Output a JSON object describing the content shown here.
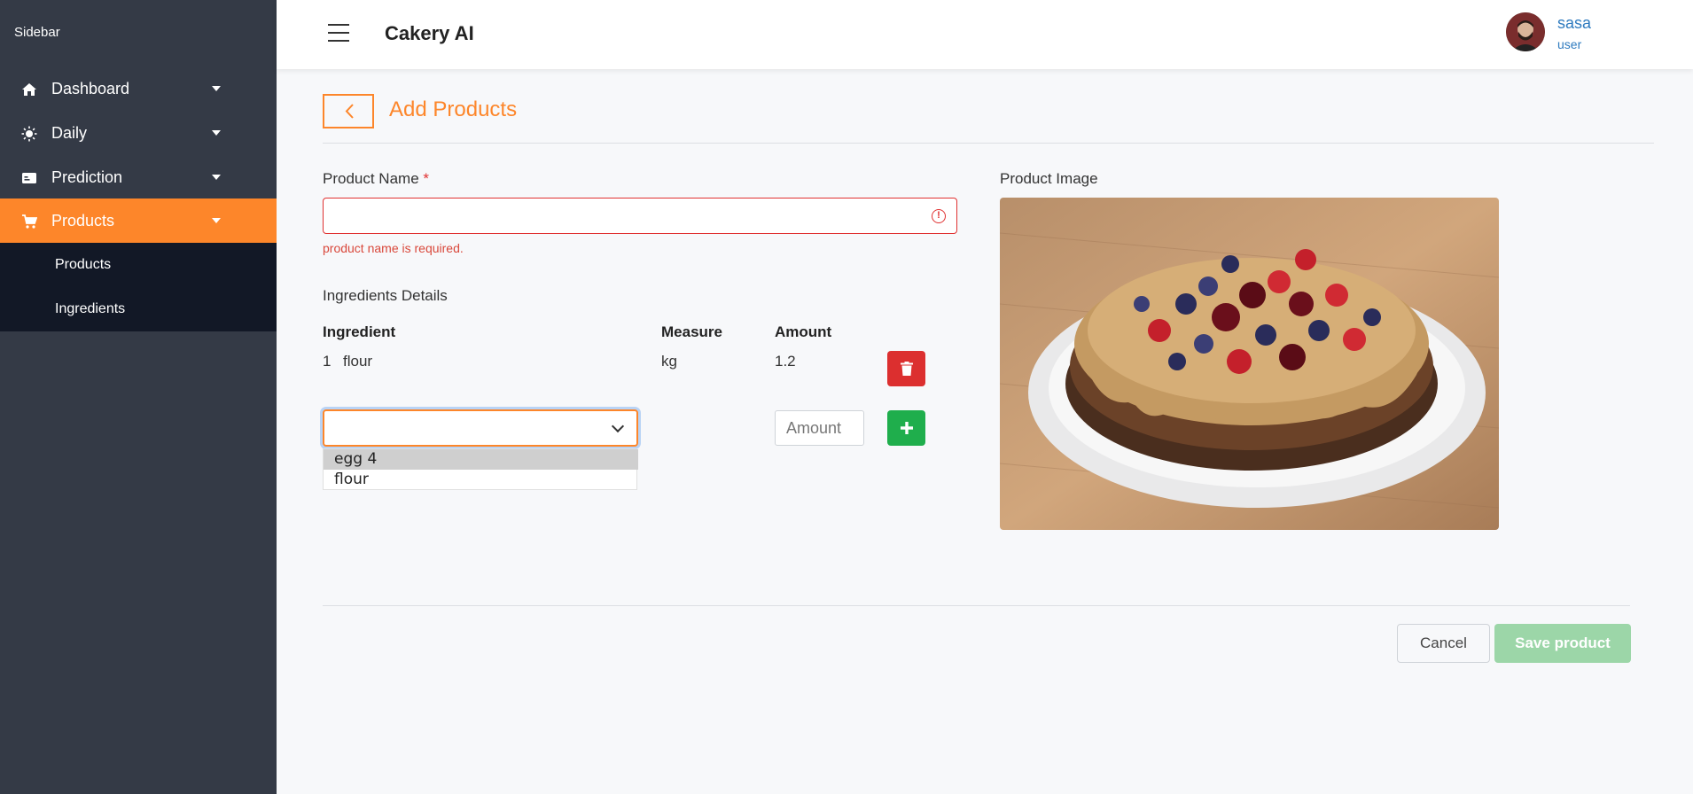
{
  "sidebar": {
    "title": "Sidebar",
    "items": [
      {
        "label": "Dashboard",
        "icon": "home-icon"
      },
      {
        "label": "Daily",
        "icon": "sun-icon"
      },
      {
        "label": "Prediction",
        "icon": "terminal-icon"
      },
      {
        "label": "Products",
        "icon": "cart-icon",
        "active": true
      }
    ],
    "submenu": [
      {
        "label": "Products"
      },
      {
        "label": "Ingredients"
      }
    ],
    "colors": {
      "background": "#343a46",
      "active": "#fd862a",
      "submenu": "#121826"
    }
  },
  "header": {
    "app_title": "Cakery AI",
    "user": {
      "name": "sasa",
      "role": "user"
    }
  },
  "page": {
    "title": "Add Products"
  },
  "form": {
    "product_name": {
      "label": "Product Name",
      "required_mark": "*",
      "value": "",
      "error": "product name is required."
    },
    "ingredients": {
      "section_label": "Ingredients Details",
      "columns": {
        "ingredient": "Ingredient",
        "measure": "Measure",
        "amount": "Amount"
      },
      "rows": [
        {
          "index": "1",
          "name": "flour",
          "measure": "kg",
          "amount": "1.2"
        }
      ],
      "new_row": {
        "select_value": "",
        "options": [
          "egg 4",
          "flour"
        ],
        "highlighted_option": "egg 4",
        "amount_placeholder": "Amount"
      }
    },
    "image_label": "Product Image"
  },
  "actions": {
    "cancel": "Cancel",
    "save": "Save product"
  },
  "colors": {
    "accent": "#fd862a",
    "error": "#e03131",
    "delete": "#dc2f2f",
    "add": "#1fae4c",
    "save_disabled": "#9cd6a8",
    "user_link": "#2f7bbf"
  }
}
